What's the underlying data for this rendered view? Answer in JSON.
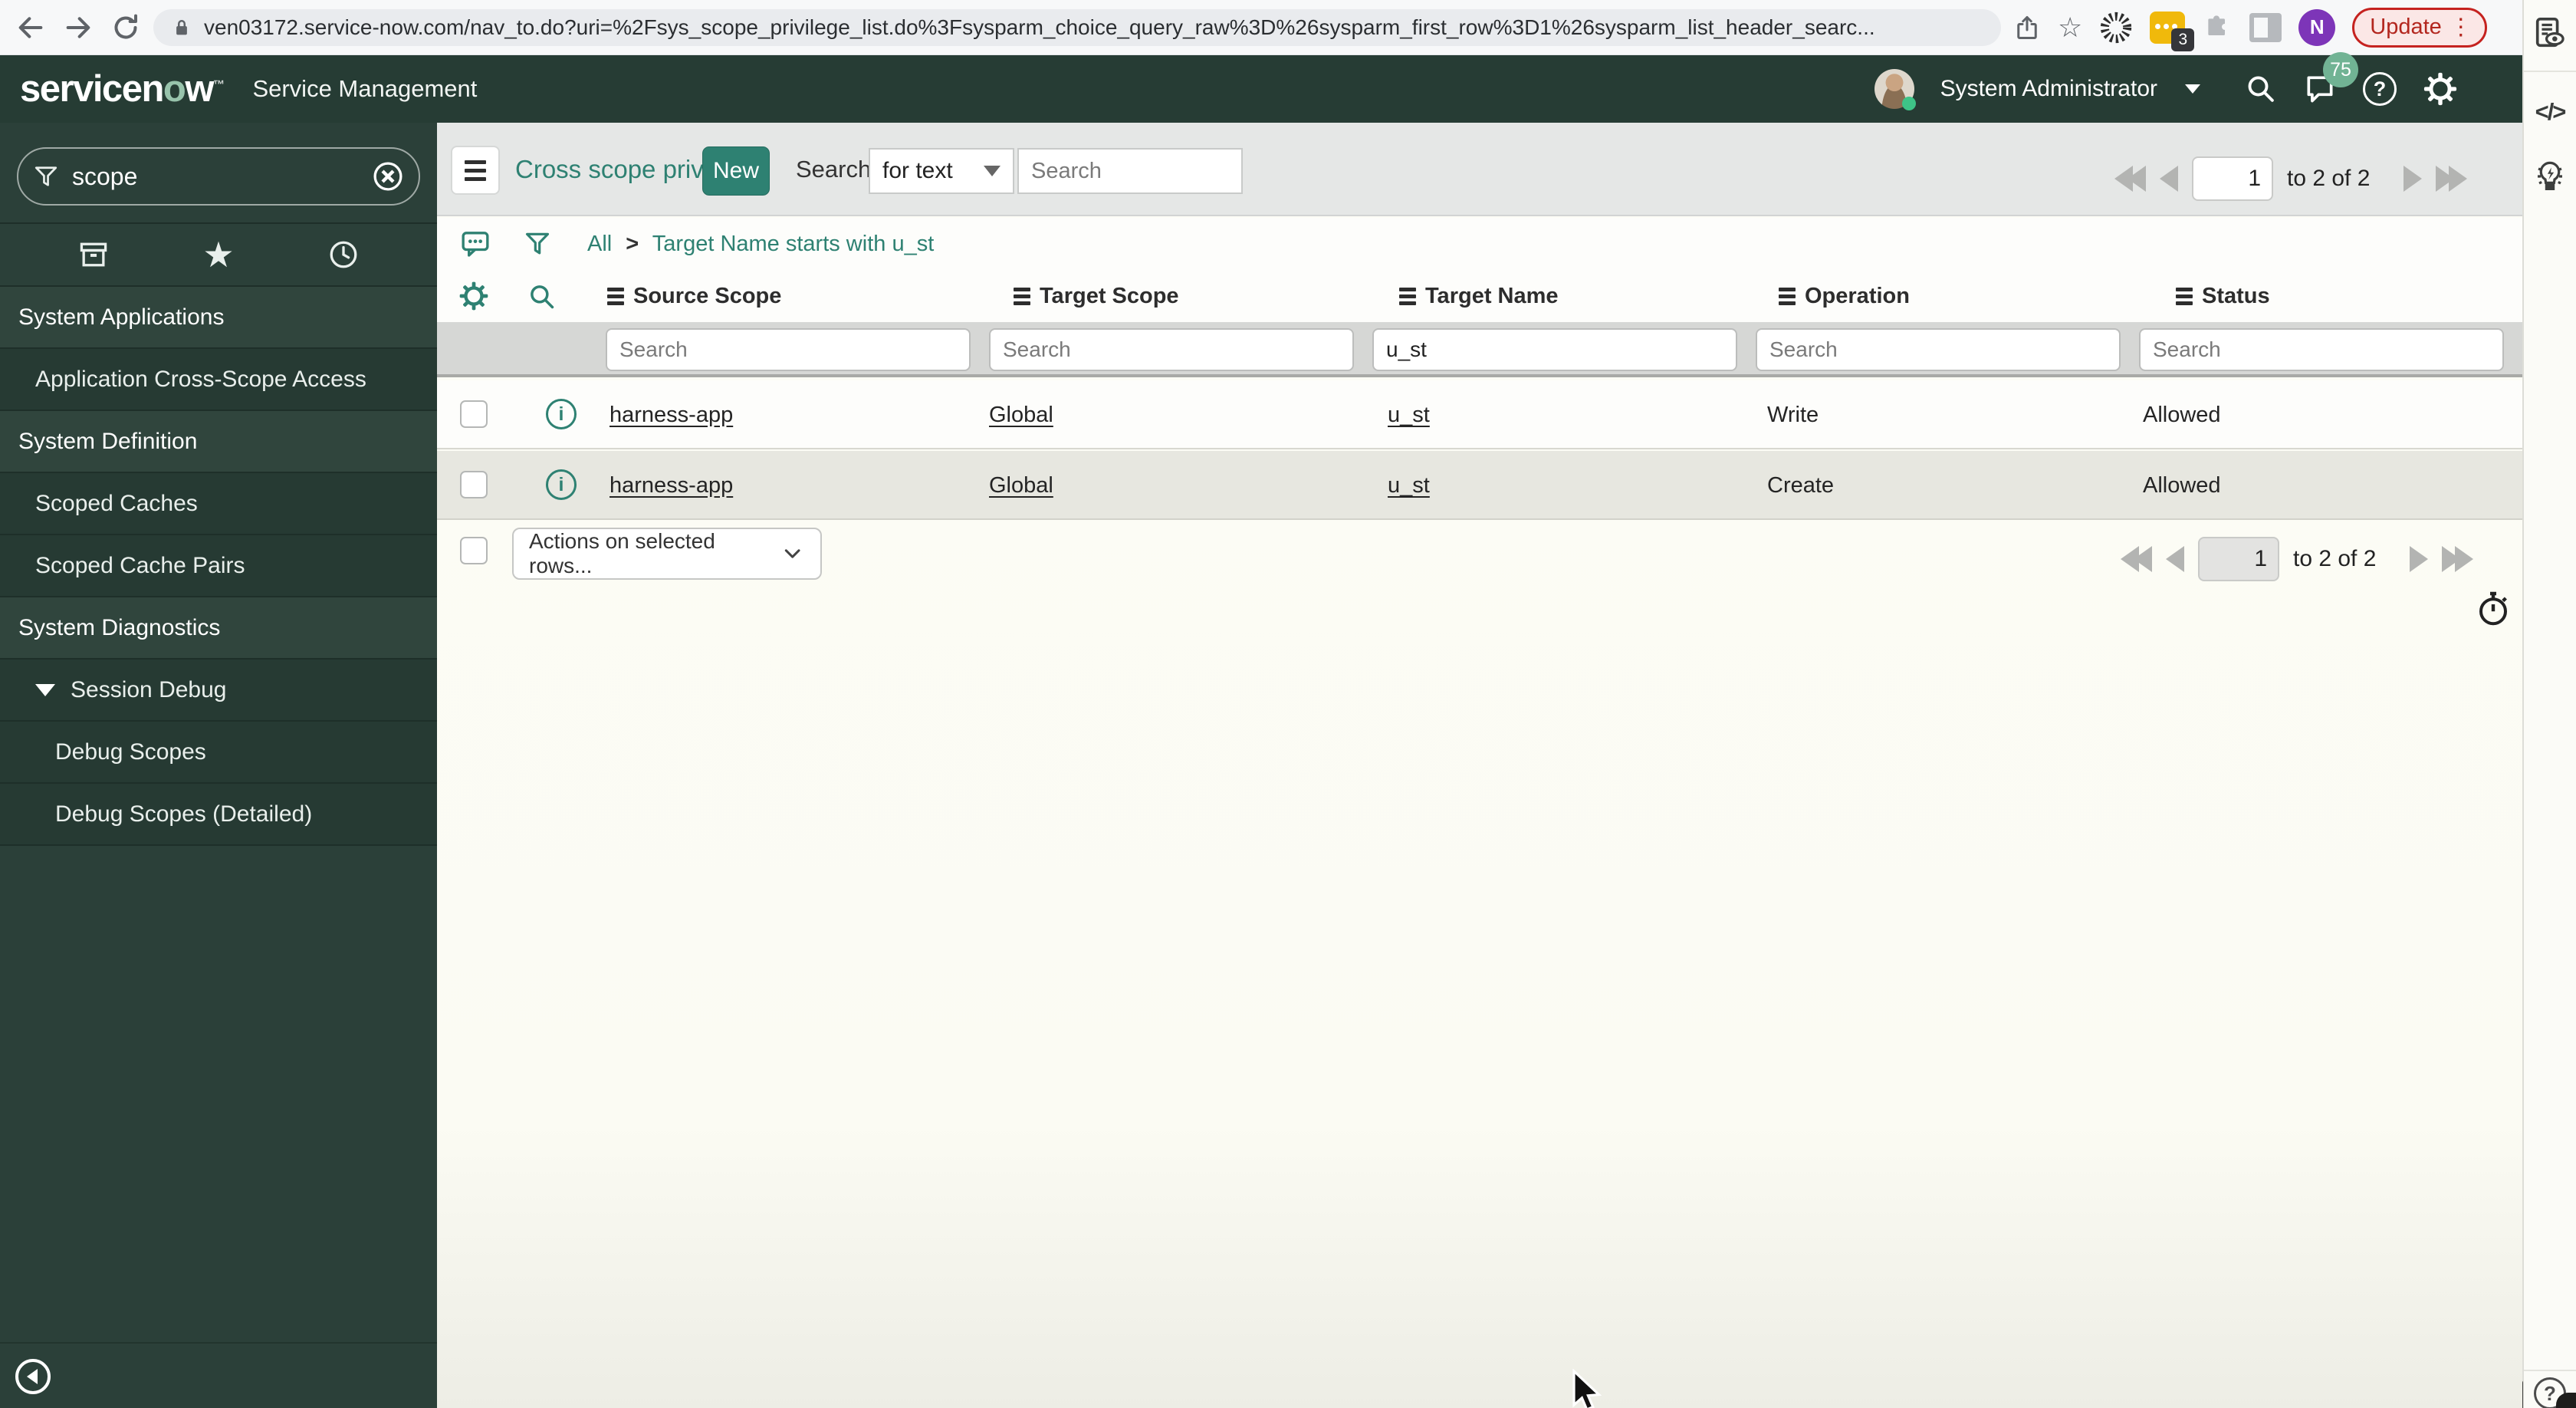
{
  "browser": {
    "url": "ven03172.service-now.com/nav_to.do?uri=%2Fsys_scope_privilege_list.do%3Fsysparm_choice_query_raw%3D%26sysparm_first_row%3D1%26sysparm_list_header_searc...",
    "update_label": "Update",
    "extension_badge": "3",
    "profile_initial": "N"
  },
  "header": {
    "logo_pre": "servicen",
    "logo_o": "o",
    "logo_post": "w",
    "product": "Service Management",
    "user": "System Administrator",
    "notification_count": "75"
  },
  "sidebar": {
    "filter_value": "scope",
    "items": [
      {
        "label": "System Applications"
      },
      {
        "label": "Application Cross-Scope Access"
      },
      {
        "label": "System Definition"
      },
      {
        "label": "Scoped Caches"
      },
      {
        "label": "Scoped Cache Pairs"
      },
      {
        "label": "System Diagnostics"
      },
      {
        "label": "Session Debug"
      },
      {
        "label": "Debug Scopes"
      },
      {
        "label": "Debug Scopes (Detailed)"
      }
    ]
  },
  "list": {
    "title": "Cross scope privileges",
    "new_button": "New",
    "search_label": "Search",
    "search_type": "for text",
    "search_placeholder": "Search",
    "breadcrumb": {
      "root": "All",
      "sep": ">",
      "filter": "Target Name starts with u_st"
    },
    "columns": [
      "Source Scope",
      "Target Scope",
      "Target Name",
      "Operation",
      "Status"
    ],
    "filter_placeholder": "Search",
    "filter_target_name": "u_st",
    "rows": [
      {
        "source_scope": "harness-app",
        "target_scope": "Global",
        "target_name": "u_st",
        "operation": "Write",
        "status": "Allowed"
      },
      {
        "source_scope": "harness-app",
        "target_scope": "Global",
        "target_name": "u_st",
        "operation": "Create",
        "status": "Allowed"
      }
    ],
    "actions_label": "Actions on selected rows...",
    "pagination": {
      "page": "1",
      "summary": "to 2 of 2"
    },
    "accent_color": "#2e8172"
  }
}
